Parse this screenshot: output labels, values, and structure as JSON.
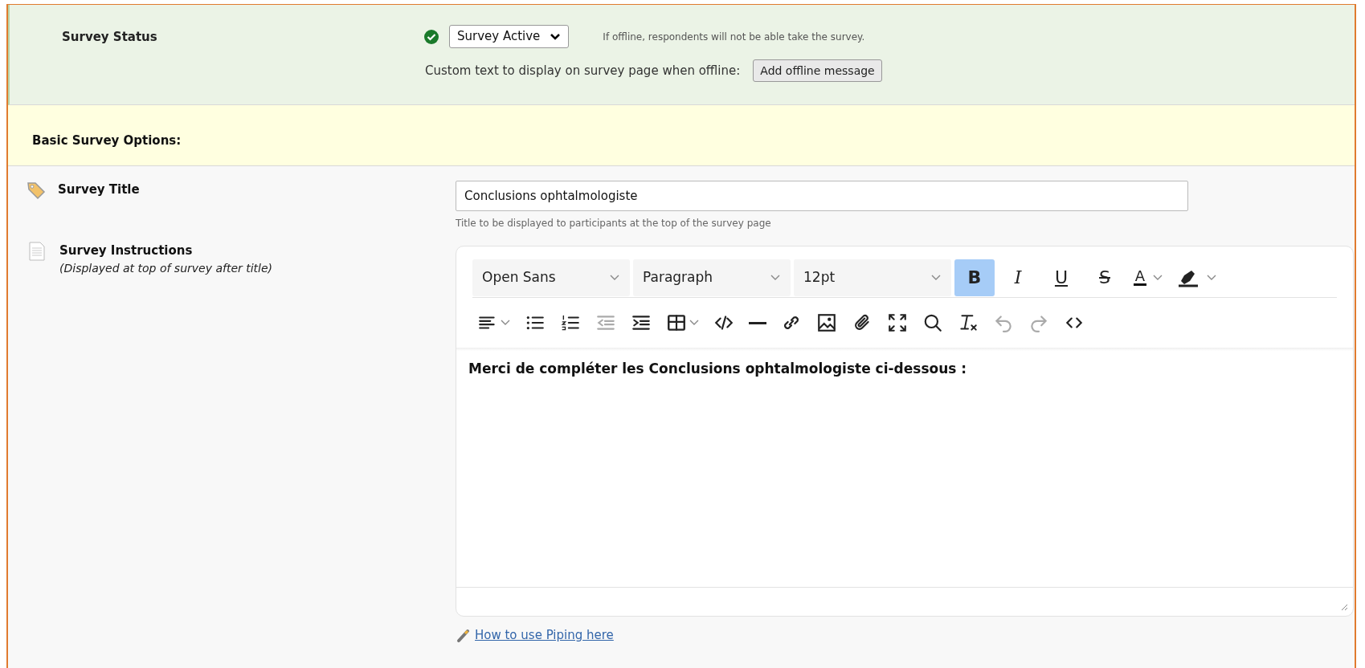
{
  "survey_status": {
    "label": "Survey Status",
    "active": true,
    "select_value": "Survey Active",
    "hint": "If offline, respondents will not be able take the survey.",
    "offline_label": "Custom text to display on survey page when offline:",
    "offline_button": "Add offline message"
  },
  "basic_options": {
    "heading": "Basic Survey Options:"
  },
  "survey_title": {
    "label": "Survey Title",
    "value": "Conclusions ophtalmologiste",
    "hint": "Title to be displayed to participants at the top of the survey page"
  },
  "survey_instructions": {
    "label": "Survey Instructions",
    "sublabel": "(Displayed at top of survey after title)",
    "toolbar_row_1": [
      {
        "kind": "select",
        "value": "Open Sans"
      },
      {
        "kind": "select",
        "value": "Paragraph"
      },
      {
        "kind": "select",
        "value": "12pt"
      },
      {
        "kind": "bold",
        "label": "B",
        "selected": true
      },
      {
        "kind": "italic",
        "label": "I",
        "selected": false
      },
      {
        "kind": "underline",
        "label": "U",
        "selected": false
      },
      {
        "kind": "strike",
        "label": "S",
        "selected": false
      },
      {
        "kind": "color",
        "label": "A",
        "selected": false
      },
      {
        "kind": "highlight",
        "selected": false
      }
    ],
    "toolbar_row_2": [
      {
        "kind": "align",
        "disabled": false
      },
      {
        "kind": "bullets",
        "disabled": false
      },
      {
        "kind": "numbers",
        "disabled": false
      },
      {
        "kind": "outdent",
        "disabled": true
      },
      {
        "kind": "indent",
        "disabled": false
      },
      {
        "kind": "table",
        "disabled": false
      },
      {
        "kind": "code",
        "disabled": false
      },
      {
        "kind": "rule",
        "disabled": false
      },
      {
        "kind": "link",
        "disabled": false
      },
      {
        "kind": "image",
        "disabled": false
      },
      {
        "kind": "attach",
        "disabled": false
      },
      {
        "kind": "fullscreen",
        "disabled": false
      },
      {
        "kind": "search",
        "disabled": false
      },
      {
        "kind": "clear",
        "disabled": false
      },
      {
        "kind": "undo",
        "disabled": true
      },
      {
        "kind": "redo",
        "disabled": true
      },
      {
        "kind": "source",
        "disabled": false
      }
    ],
    "content": "Merci de compléter les Conclusions ophtalmologiste ci-dessous :",
    "piping_link": "How to use Piping here"
  }
}
